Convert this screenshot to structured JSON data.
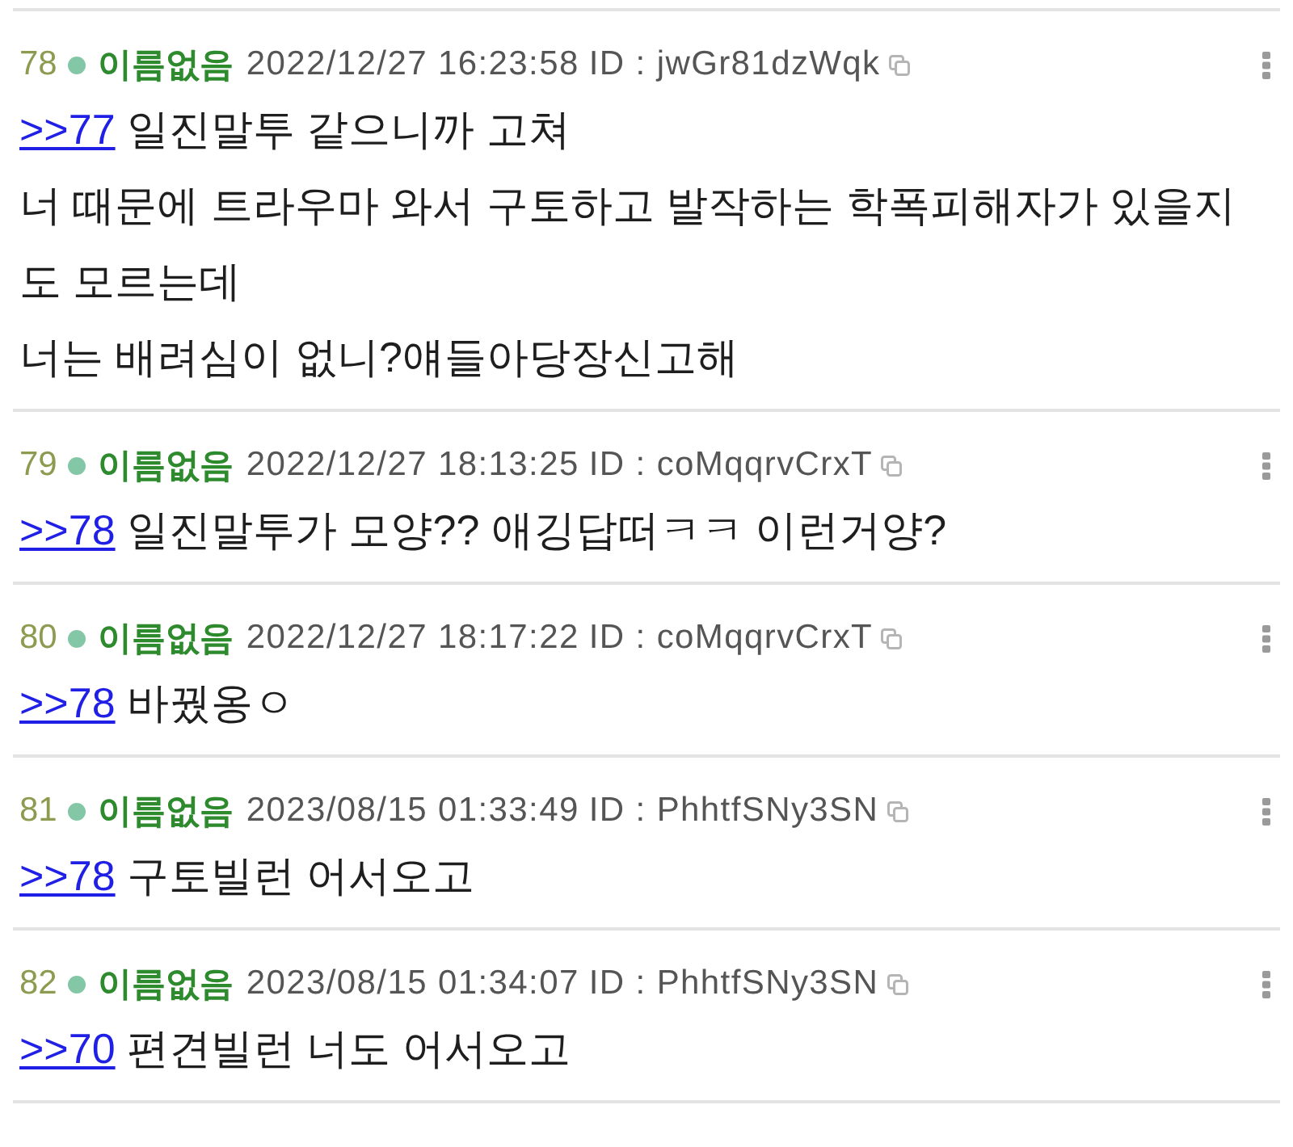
{
  "posts": [
    {
      "number": "78",
      "name": "이름없음",
      "datetime": "2022/12/27 16:23:58",
      "user_id": "ID : jwGr81dzWqk",
      "reply_to": ">>77",
      "text": "일진말투 같으니까 고쳐\n너 때문에 트라우마 와서 구토하고 발작하는 학폭피해자가 있을지도 모르는데\n너는 배려심이 없니?얘들아당장신고해"
    },
    {
      "number": "79",
      "name": "이름없음",
      "datetime": "2022/12/27 18:13:25",
      "user_id": "ID : coMqqrvCrxT",
      "reply_to": ">>78",
      "text": "일진말투가 모양?? 애깅답떠ㅋㅋ 이런거양?"
    },
    {
      "number": "80",
      "name": "이름없음",
      "datetime": "2022/12/27 18:17:22",
      "user_id": "ID : coMqqrvCrxT",
      "reply_to": ">>78",
      "text": "바꿨옹ㅇ"
    },
    {
      "number": "81",
      "name": "이름없음",
      "datetime": "2023/08/15 01:33:49",
      "user_id": "ID : PhhtfSNy3SN",
      "reply_to": ">>78",
      "text": "구토빌런 어서오고"
    },
    {
      "number": "82",
      "name": "이름없음",
      "datetime": "2023/08/15 01:34:07",
      "user_id": "ID : PhhtfSNy3SN",
      "reply_to": ">>70",
      "text": "편견빌런 너도 어서오고"
    }
  ]
}
